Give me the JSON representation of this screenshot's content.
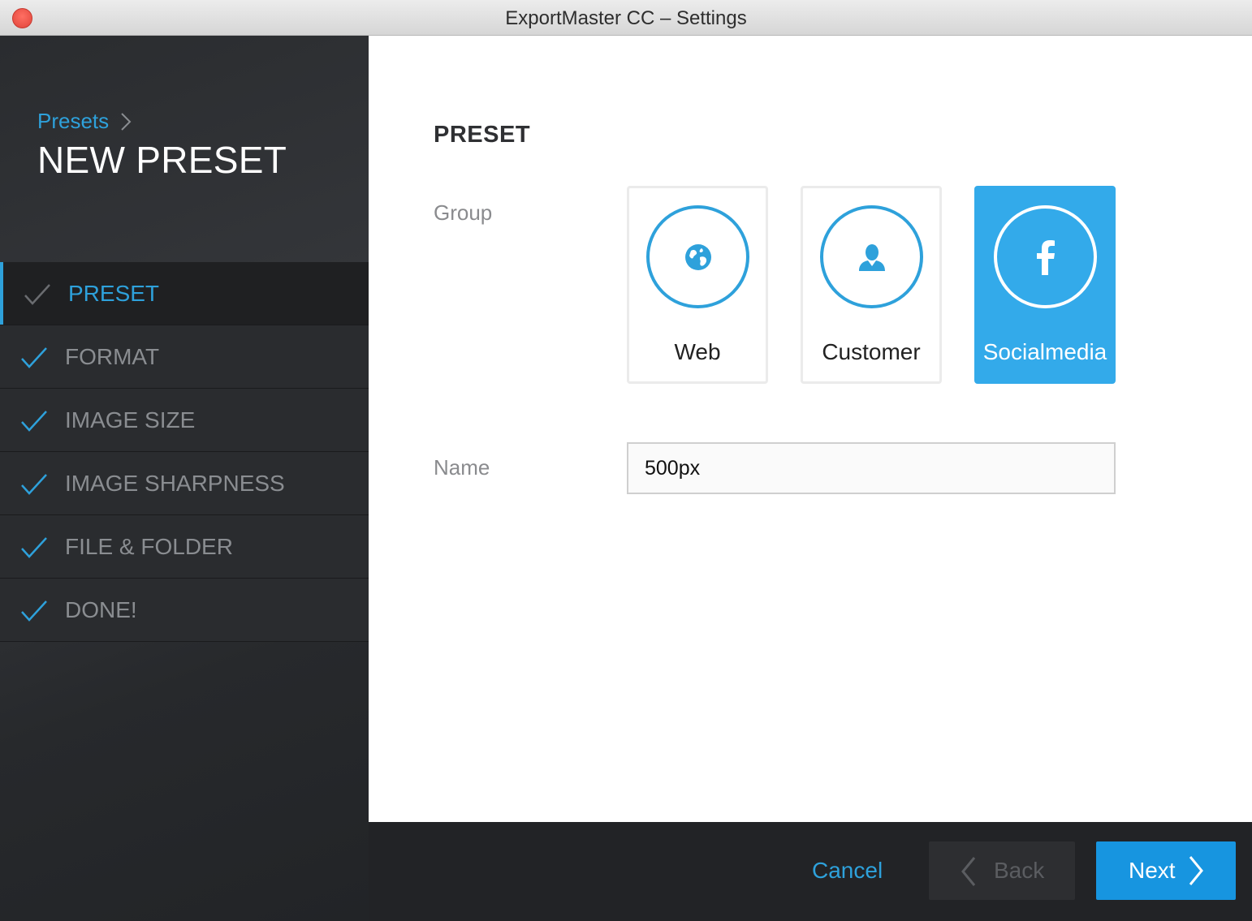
{
  "window": {
    "title": "ExportMaster CC – Settings"
  },
  "sidebar": {
    "breadcrumb": "Presets",
    "page_title": "NEW PRESET",
    "steps": [
      {
        "label": "PRESET",
        "active": true
      },
      {
        "label": "FORMAT"
      },
      {
        "label": "IMAGE SIZE"
      },
      {
        "label": "IMAGE SHARPNESS"
      },
      {
        "label": "FILE & FOLDER"
      },
      {
        "label": "DONE!"
      }
    ]
  },
  "main": {
    "section_title": "PRESET",
    "group_label": "Group",
    "groups": [
      {
        "label": "Web",
        "icon": "globe-icon",
        "selected": false
      },
      {
        "label": "Customer",
        "icon": "user-icon",
        "selected": false
      },
      {
        "label": "Socialmedia",
        "icon": "facebook-icon",
        "selected": true
      }
    ],
    "name_label": "Name",
    "name_value": "500px"
  },
  "footer": {
    "cancel_label": "Cancel",
    "back_label": "Back",
    "next_label": "Next"
  },
  "colors": {
    "accent": "#2ea1db",
    "selected_card": "#33aaea",
    "next_button": "#1795e0",
    "sidebar_bg": "#2a2c2f",
    "footer_bg": "#222326"
  }
}
